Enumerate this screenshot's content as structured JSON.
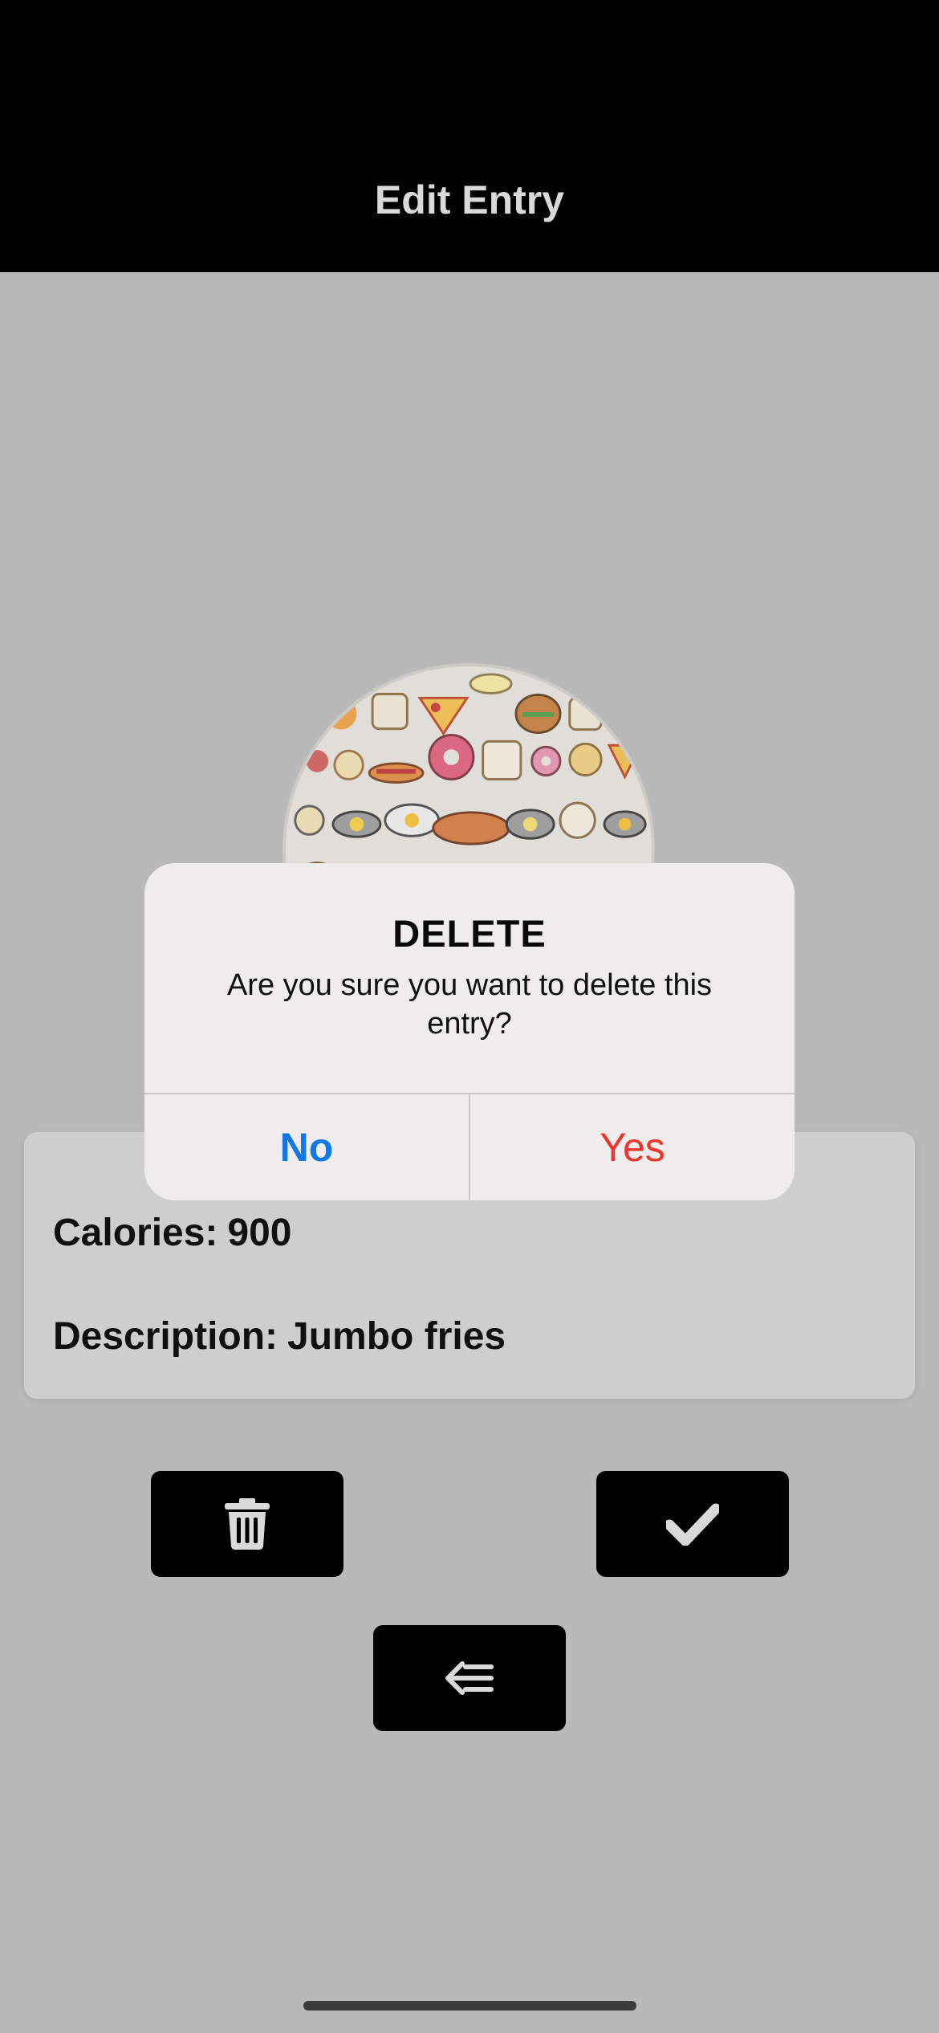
{
  "header": {
    "title": "Edit Entry"
  },
  "entry": {
    "calories_label": "Calories:",
    "calories_value": "900",
    "description_label": "Description:",
    "description_value": "Jumbo fries"
  },
  "actions": {
    "delete_icon": "trash-icon",
    "confirm_icon": "checkmark-icon",
    "back_icon": "back-arrow-icon"
  },
  "alert": {
    "title": "DELETE",
    "message": "Are you sure you want to delete this entry?",
    "no_label": "No",
    "yes_label": "Yes"
  },
  "colors": {
    "header_bg": "#000000",
    "background": "#b9b9b9",
    "no_button": "#1477e6",
    "yes_button": "#e8372e"
  }
}
